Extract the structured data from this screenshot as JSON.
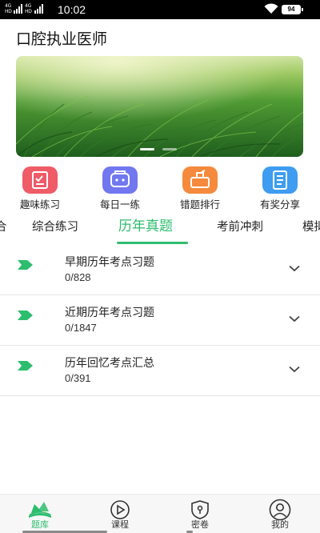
{
  "status_bar": {
    "network_1": [
      "4G",
      "HD"
    ],
    "network_2": [
      "4G",
      "HD"
    ],
    "time": "10:02",
    "battery": "94"
  },
  "page_title": "口腔执业医师",
  "quick_actions": [
    {
      "label": "趣味练习",
      "icon": "interest-practice-icon",
      "color": "#ef5b67"
    },
    {
      "label": "每日一练",
      "icon": "daily-practice-icon",
      "color": "#7277f0"
    },
    {
      "label": "错题排行",
      "icon": "wrong-ranking-icon",
      "color": "#f58a3c"
    },
    {
      "label": "有奖分享",
      "icon": "share-reward-icon",
      "color": "#3e9df0"
    }
  ],
  "tabs": [
    {
      "label": "合"
    },
    {
      "label": "综合练习"
    },
    {
      "label": "历年真题"
    },
    {
      "label": "考前冲刺"
    },
    {
      "label": "模拟"
    }
  ],
  "active_tab": "历年真题",
  "list": [
    {
      "title": "早期历年考点习题",
      "count": "0/828"
    },
    {
      "title": "近期历年考点习题",
      "count": "0/1847"
    },
    {
      "title": "历年回忆考点汇总",
      "count": "0/391"
    }
  ],
  "bottom_nav": [
    {
      "label": "题库",
      "icon": "question-bank-icon",
      "active": true
    },
    {
      "label": "课程",
      "icon": "course-play-icon",
      "active": false
    },
    {
      "label": "密卷",
      "icon": "secret-paper-lock-icon",
      "active": false
    },
    {
      "label": "我的",
      "icon": "profile-icon",
      "active": false
    }
  ],
  "colors": {
    "accent": "#2dbd6e",
    "text": "#222222",
    "divider": "#e6e6e6"
  }
}
